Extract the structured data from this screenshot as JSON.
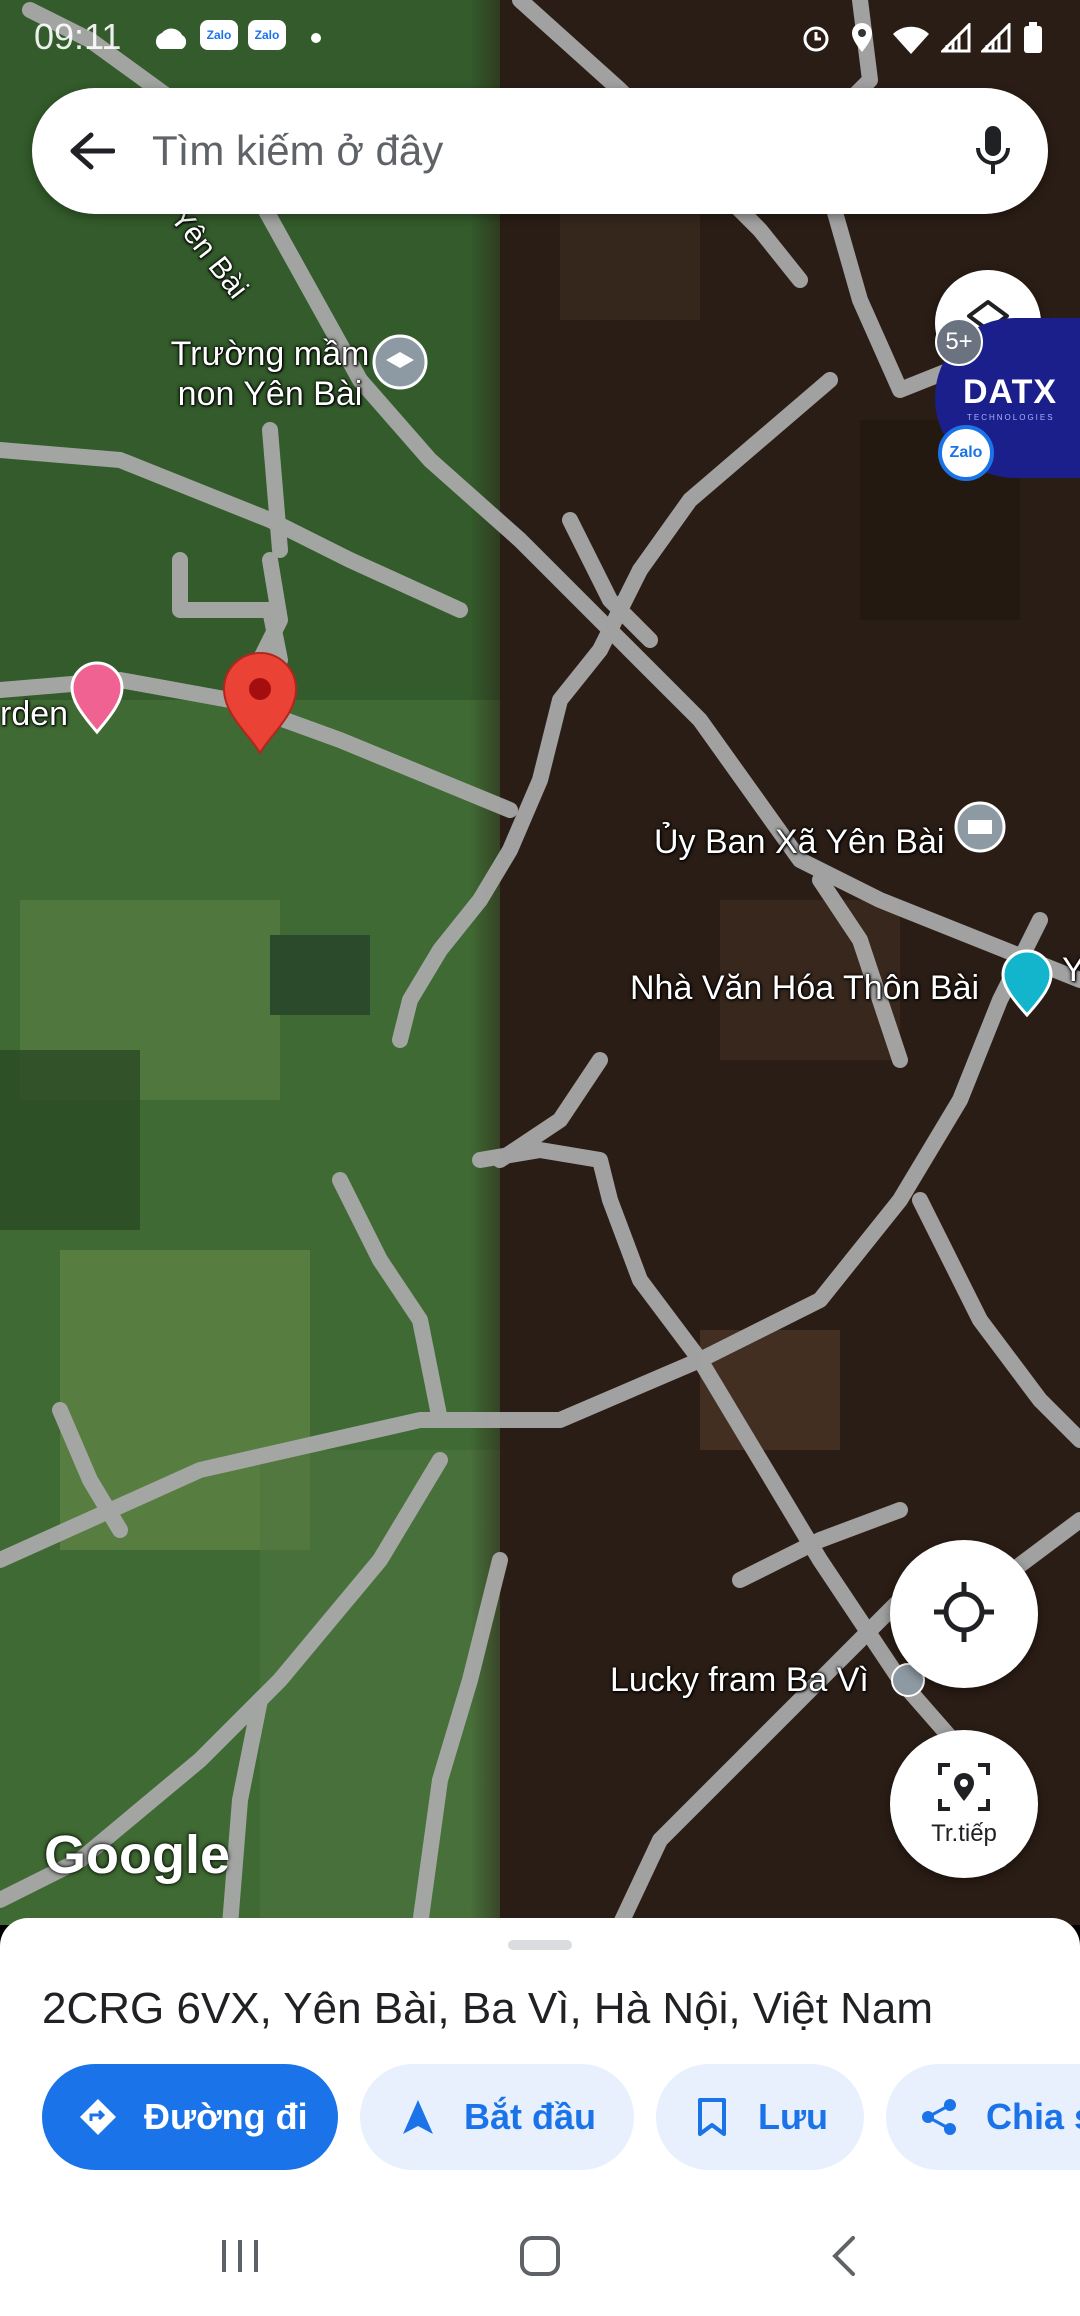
{
  "status_bar": {
    "time": "09:11",
    "icons": [
      "cloud-icon",
      "zalo-icon",
      "zalo-icon",
      "dot-icon",
      "alarm-icon",
      "location-icon",
      "wifi-icon",
      "signal-icon",
      "signal-icon",
      "battery-icon"
    ],
    "zalo_label": "Zalo"
  },
  "search": {
    "placeholder": "Tìm kiếm ở đây",
    "back_icon": "arrow-back-icon",
    "mic_icon": "microphone-icon"
  },
  "map": {
    "labels": {
      "street": "Yên Bài",
      "school_line1": "Trường mầm",
      "school_line2": "non Yên Bài",
      "garden": "rden",
      "committee": "Ủy Ban Xã Yên Bài",
      "culture_house": "Nhà Văn Hóa Thôn Bài",
      "culture_house_cut": "Y",
      "farm": "Lucky fram Ba Vì"
    },
    "brand": "Google",
    "colors": {
      "road": "#a9a9a9",
      "pin": "#ea4335",
      "dark_area": "#2a1d15",
      "green_area": "#3f6a33"
    }
  },
  "overlay": {
    "badge": "5+",
    "datx_logo": "DATX",
    "datx_sub": "TECHNOLOGIES",
    "zalo_chat": "Zalo"
  },
  "controls": {
    "layers_icon": "layers-icon",
    "my_location_icon": "my-location-icon",
    "live_view_label": "Tr.tiếp"
  },
  "sheet": {
    "address": "2CRG 6VX, Yên Bài, Ba Vì, Hà Nội, Việt Nam",
    "actions": [
      {
        "label": "Đường đi",
        "icon": "directions-icon"
      },
      {
        "label": "Bắt đầu",
        "icon": "navigation-arrow-icon"
      },
      {
        "label": "Lưu",
        "icon": "bookmark-icon"
      },
      {
        "label": "Chia s",
        "icon": "share-icon"
      }
    ]
  },
  "nav": {
    "icons": [
      "recents-icon",
      "home-icon",
      "back-icon"
    ]
  }
}
